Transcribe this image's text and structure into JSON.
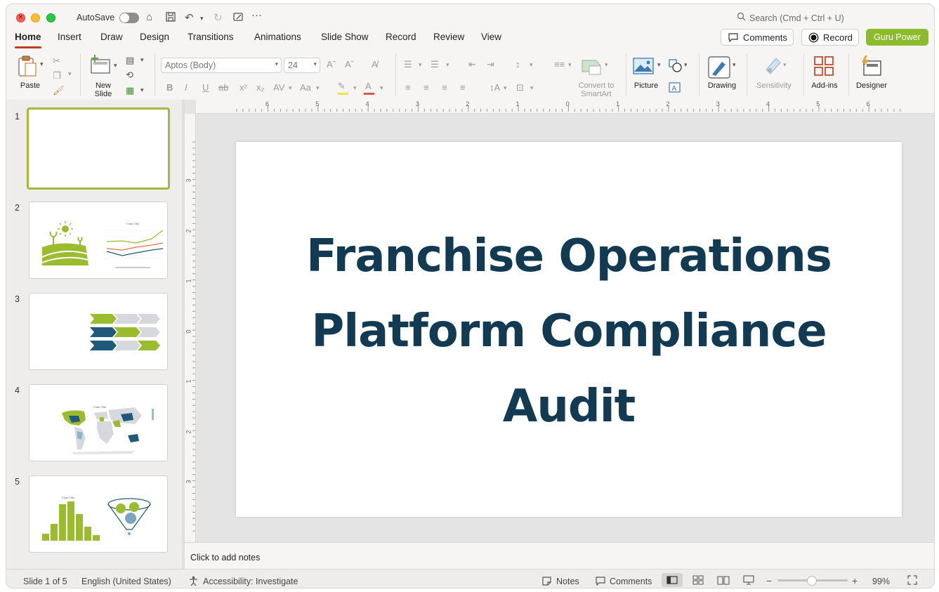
{
  "titlebar": {
    "autosave_label": "AutoSave",
    "search_placeholder": "Search (Cmd + Ctrl + U)"
  },
  "tabs": [
    {
      "label": "Home",
      "active": true
    },
    {
      "label": "Insert"
    },
    {
      "label": "Draw"
    },
    {
      "label": "Design"
    },
    {
      "label": "Transitions"
    },
    {
      "label": "Animations"
    },
    {
      "label": "Slide Show"
    },
    {
      "label": "Record"
    },
    {
      "label": "Review"
    },
    {
      "label": "View"
    }
  ],
  "header_buttons": {
    "comments": "Comments",
    "record": "Record",
    "guru": "Guru Power"
  },
  "ribbon": {
    "paste": "Paste",
    "new_slide": "New\nSlide",
    "font_name": "Aptos (Body)",
    "font_size": "24",
    "convert_smartart": "Convert to\nSmartArt",
    "picture": "Picture",
    "drawing": "Drawing",
    "sensitivity": "Sensitivity",
    "addins": "Add-ins",
    "designer": "Designer"
  },
  "slides": [
    {
      "number": "1",
      "selected": true
    },
    {
      "number": "2",
      "chart_title": "Chart Title"
    },
    {
      "number": "3"
    },
    {
      "number": "4",
      "chart_title": "Chart Title"
    },
    {
      "number": "5",
      "chart_title": "Chart Title"
    }
  ],
  "ruler_top": [
    "6",
    "5",
    "4",
    "3",
    "2",
    "1",
    "0",
    "1",
    "2",
    "3",
    "4",
    "5",
    "6"
  ],
  "ruler_left": [
    "3",
    "2",
    "1",
    "0",
    "1",
    "2",
    "3"
  ],
  "slide_title": "Franchise Operations Platform Compliance Audit",
  "notes_placeholder": "Click to add notes",
  "status": {
    "slide_count": "Slide 1 of 5",
    "language": "English (United States)",
    "accessibility": "Accessibility: Investigate",
    "notes": "Notes",
    "comments": "Comments",
    "zoom": "99%"
  },
  "colors": {
    "accent_tab": "#c43e1c",
    "guru": "#8cbb2d",
    "title_text": "#123a52",
    "thumb_green": "#9cbc30",
    "thumb_navy": "#1f5a7a"
  }
}
